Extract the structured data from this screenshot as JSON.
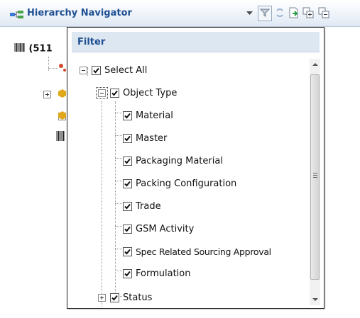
{
  "header": {
    "title": "Hierarchy Navigator"
  },
  "background": {
    "root_label": "(511"
  },
  "filter": {
    "title": "Filter",
    "select_all": {
      "label": "Select All",
      "checked": true,
      "expanded": true
    },
    "object_type": {
      "label": "Object Type",
      "checked": true,
      "expanded": true,
      "children": [
        {
          "label": "Material",
          "checked": true
        },
        {
          "label": "Master",
          "checked": true
        },
        {
          "label": "Packaging Material",
          "checked": true
        },
        {
          "label": "Packing Configuration",
          "checked": true
        },
        {
          "label": "Trade",
          "checked": true
        },
        {
          "label": "GSM Activity",
          "checked": true
        },
        {
          "label": "Spec Related Sourcing Approval",
          "checked": true
        },
        {
          "label": "Formulation",
          "checked": true
        }
      ]
    },
    "status": {
      "label": "Status",
      "checked": true,
      "expanded": false
    }
  },
  "icons": {
    "header": "hierarchy-tree-icon",
    "toolbar": [
      "dropdown-arrow-icon",
      "filter-icon",
      "refresh-icon",
      "export-icon",
      "expand-all-icon",
      "collapse-all-icon"
    ]
  },
  "colors": {
    "title_blue": "#1d4f91",
    "popup_header_bg": "#dde7f2"
  }
}
